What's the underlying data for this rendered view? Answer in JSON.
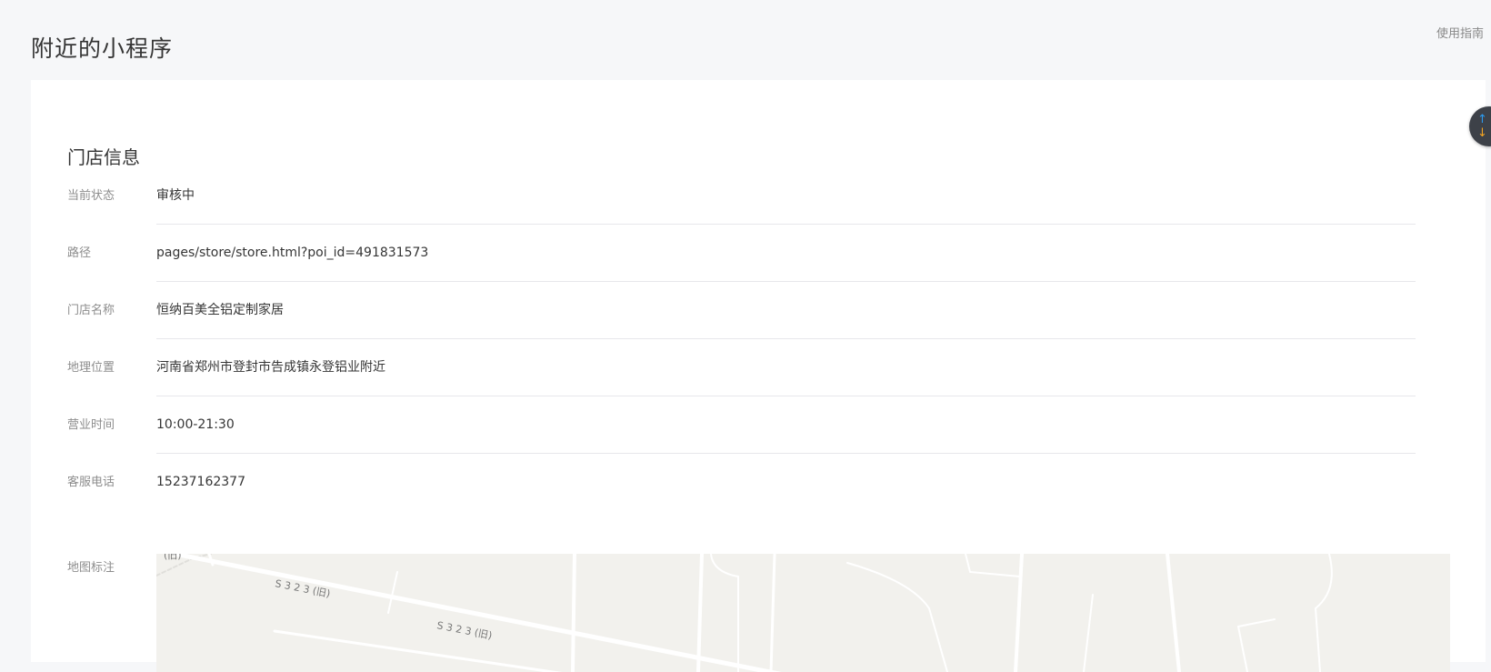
{
  "header": {
    "title": "附近的小程序",
    "guide_link": "使用指南"
  },
  "section": {
    "title": "门店信息"
  },
  "rows": [
    {
      "label": "当前状态",
      "value": "审核中"
    },
    {
      "label": "路径",
      "value": "pages/store/store.html?poi_id=491831573"
    },
    {
      "label": "门店名称",
      "value": "恒纳百美全铝定制家居"
    },
    {
      "label": "地理位置",
      "value": "河南省郑州市登封市告成镇永登铝业附近"
    },
    {
      "label": "营业时间",
      "value": "10:00-21:30"
    },
    {
      "label": "客服电话",
      "value": "15237162377"
    }
  ],
  "map": {
    "label": "地图标注",
    "road_labels": [
      "(旧)",
      "S 3 2 3 (旧)",
      "S 3 2 3 (旧)"
    ]
  },
  "scroll_widget": {
    "up_icon": "arrow-up-icon",
    "down_icon": "arrow-down-icon"
  }
}
